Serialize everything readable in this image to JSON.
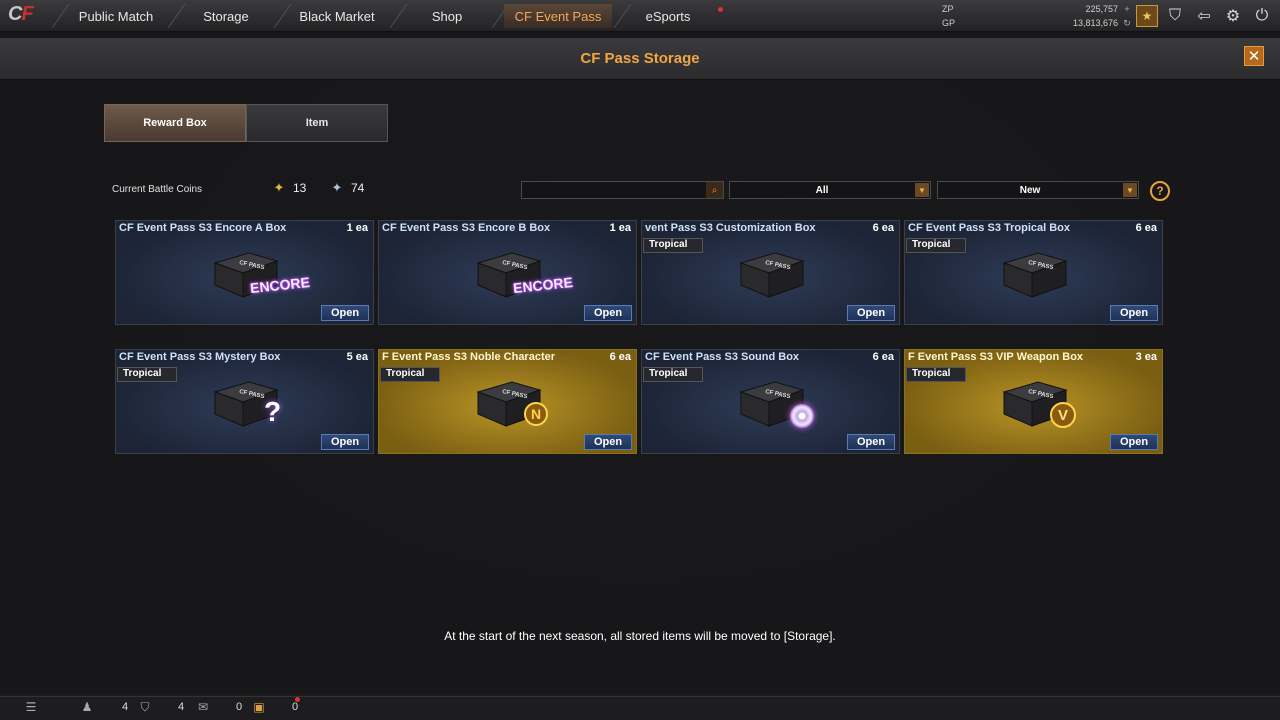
{
  "nav": {
    "tabs": [
      {
        "label": "Public Match"
      },
      {
        "label": "Storage"
      },
      {
        "label": "Black Market"
      },
      {
        "label": "Shop"
      },
      {
        "label": "CF Event Pass"
      },
      {
        "label": "eSports"
      }
    ],
    "active_tab": "CF Event Pass",
    "currency": {
      "zp_label": "ZP",
      "zp_value": "225,757",
      "gp_label": "GP",
      "gp_value": "13,813,676"
    },
    "icons": [
      "rank-icon",
      "clan-icon",
      "exit-room-icon",
      "settings-gear-icon",
      "power-icon"
    ]
  },
  "dialog": {
    "title": "CF Pass Storage",
    "tabs": [
      {
        "label": "Reward Box"
      },
      {
        "label": "Item"
      }
    ],
    "active_tab": "Reward Box",
    "coins_label": "Current Battle Coins",
    "gold_coins": "13",
    "silver_coins": "74",
    "search": {
      "value": "",
      "placeholder": ""
    },
    "filter_category": "All",
    "filter_sort": "New",
    "notice": "At the start of the next season, all stored items will be moved to [Storage].",
    "open_label": "Open",
    "tag_label": "Tropical",
    "boxes": [
      {
        "name": "CF Event Pass S3 Encore A Box",
        "qty": "1 ea",
        "tag": "",
        "style": "blue",
        "overlay": "ENCORE"
      },
      {
        "name": "CF Event Pass S3 Encore B Box",
        "qty": "1 ea",
        "tag": "",
        "style": "blue",
        "overlay": "ENCORE"
      },
      {
        "name": "vent Pass S3 Customization Box",
        "qty": "6 ea",
        "tag": "Tropical",
        "style": "blue",
        "overlay": ""
      },
      {
        "name": "CF Event Pass S3 Tropical Box",
        "qty": "6 ea",
        "tag": "Tropical",
        "style": "blue",
        "overlay": ""
      },
      {
        "name": "CF Event Pass S3 Mystery Box",
        "qty": "5 ea",
        "tag": "Tropical",
        "style": "blue",
        "overlay": "?"
      },
      {
        "name": "F Event Pass S3 Noble Character",
        "qty": "6 ea",
        "tag": "Tropical",
        "style": "gold",
        "overlay": "N"
      },
      {
        "name": "CF Event Pass S3 Sound Box",
        "qty": "6 ea",
        "tag": "Tropical",
        "style": "blue",
        "overlay": "disc"
      },
      {
        "name": "F Event Pass S3 VIP Weapon Box",
        "qty": "3 ea",
        "tag": "Tropical",
        "style": "gold",
        "overlay": "V"
      }
    ]
  },
  "statusbar": {
    "friends_count": "4",
    "clan_count": "4",
    "messages_count": "0",
    "gifts_count": "0"
  }
}
